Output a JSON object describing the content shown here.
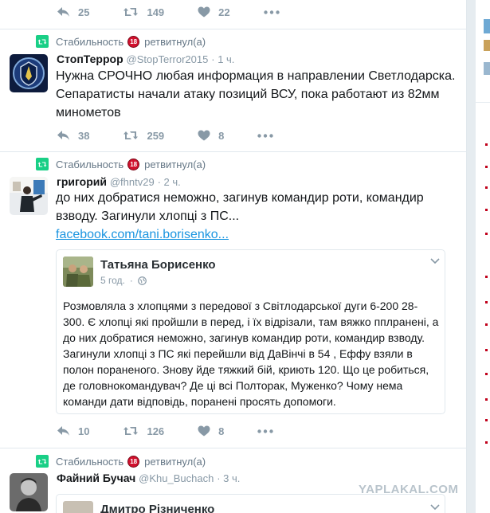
{
  "tweets": [
    {
      "actions": {
        "reply": "25",
        "retweet": "149",
        "like": "22"
      }
    },
    {
      "context": {
        "retweeter": "Стабильность",
        "action": "ретвитнул(а)",
        "badge": "18"
      },
      "name": "СтопТеррор",
      "handle": "@StopTerror2015",
      "time": "1 ч.",
      "text": "Нужна СРОЧНО любая информация в направлении Светлодарска. Сепаратисты начали атаку позиций ВСУ, пока работают из 82мм минометов",
      "actions": {
        "reply": "38",
        "retweet": "259",
        "like": "8"
      }
    },
    {
      "context": {
        "retweeter": "Стабильность",
        "action": "ретвитнул(а)",
        "badge": "18"
      },
      "name": "григорий",
      "handle": "@fhntv29",
      "time": "2 ч.",
      "text": "до них добратися неможно, загинув командир роти, командир взводу. Загинули хлопці з ПС...",
      "link": "facebook.com/tani.borisenko...",
      "card": {
        "name": "Татьяна Борисенко",
        "time": "5 год.",
        "text": "Розмовляла з хлопцями з передової з Світлодарської дуги 6-200 28-300. Є хлопці які пройшли в перед, і їх відрізали, там вяжко пплранені, а до них добратися неможно, загинув командир роти, командир взводу. Загинули хлопці з ПС які перейшли від ДаВінчі в 54 , Еффу взяли в полон пораненого. Знову йде тяжкий бій, криють 120. Що це робиться, де головнокомандувач? Де ці всі Полторак, Муженко? Чому нема команди дати відповідь, поранені просять допомоги."
      },
      "actions": {
        "reply": "10",
        "retweet": "126",
        "like": "8"
      }
    },
    {
      "context": {
        "retweeter": "Стабильность",
        "action": "ретвитнул(а)",
        "badge": "18"
      },
      "name": "Файний Бучач",
      "handle": "@Khu_Buchach",
      "time": "3 ч.",
      "card_name": "Дмитро Різниченко"
    }
  ],
  "watermark": "YAPLAKAL.COM",
  "colors": {
    "accent": "#1b95e0",
    "retweet_green": "#19cf86",
    "muted": "#8899a6"
  }
}
